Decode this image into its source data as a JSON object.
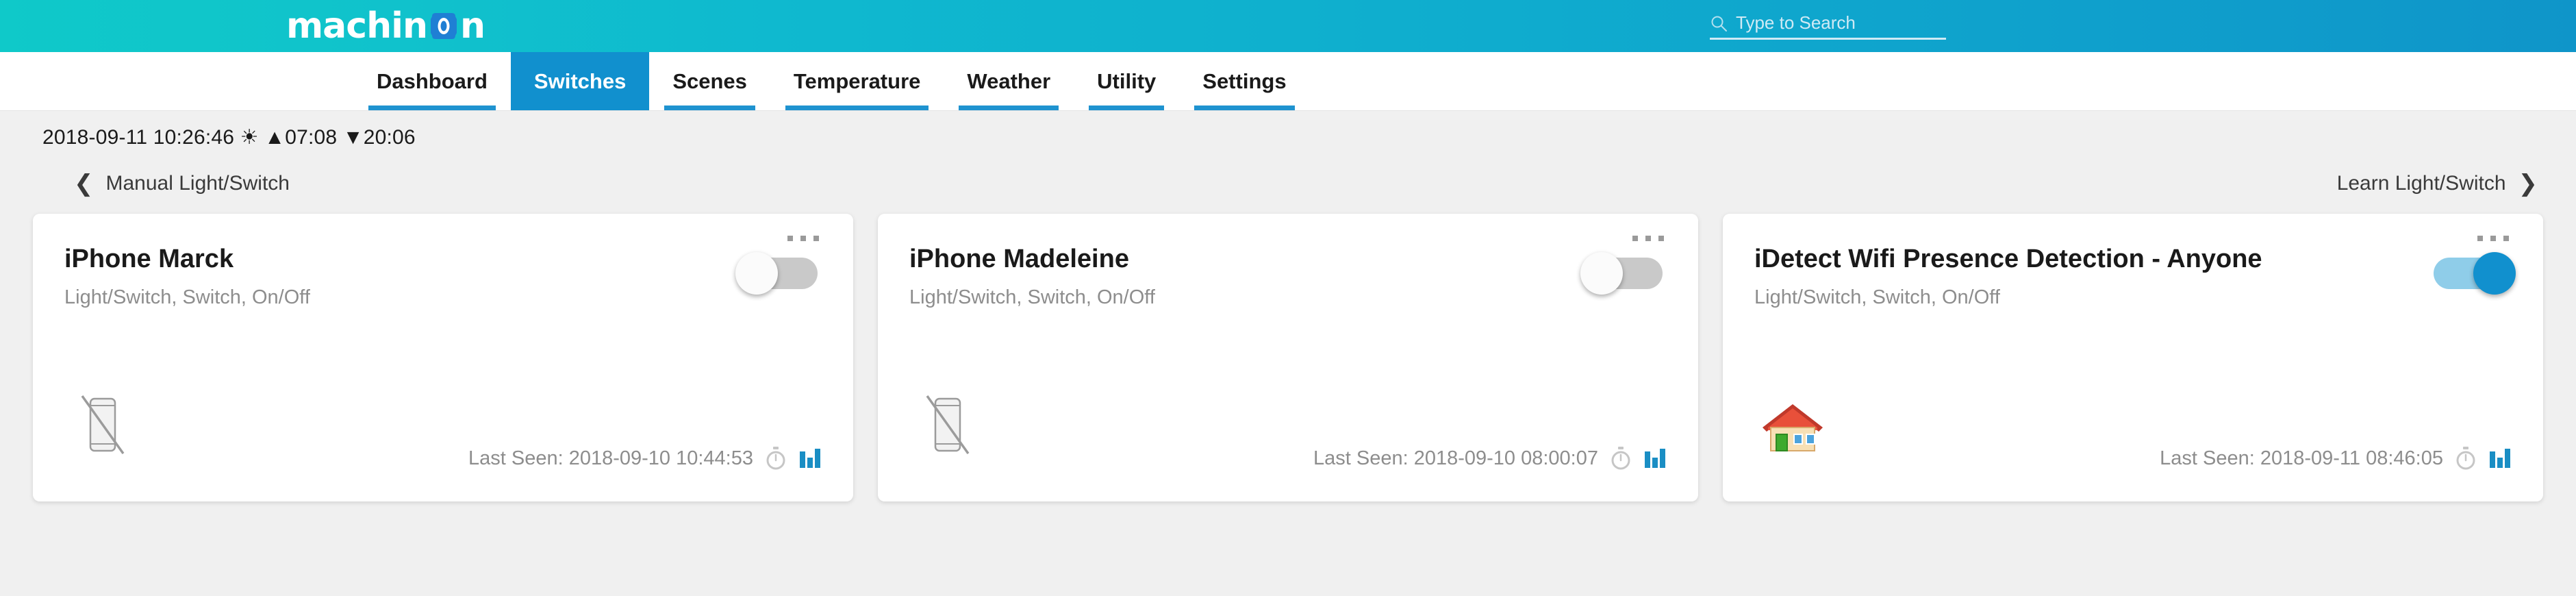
{
  "header": {
    "logo_text_before": "machin",
    "logo_text_after": "n",
    "logo_o_icon": "logo-o-icon",
    "brand_gradient_from": "#0fc9c9",
    "brand_gradient_to": "#0f95c9",
    "search": {
      "icon": "search-icon",
      "placeholder": "Type to Search",
      "value": ""
    }
  },
  "nav": {
    "active_index": 1,
    "active_bg": "#1190ce",
    "underline_color": "#1f93d0",
    "tabs": [
      {
        "label": "Dashboard"
      },
      {
        "label": "Switches"
      },
      {
        "label": "Scenes"
      },
      {
        "label": "Temperature"
      },
      {
        "label": "Weather"
      },
      {
        "label": "Utility"
      },
      {
        "label": "Settings"
      }
    ]
  },
  "statusbar": {
    "text": "2018-09-11 10:26:46 ☀ ▲07:08 ▼20:06",
    "datetime": "2018-09-11 10:26:46",
    "sun_icon": "sun-icon",
    "sunrise_icon": "▲",
    "sunrise": "07:08",
    "sunset_icon": "▼",
    "sunset": "20:06"
  },
  "category_nav": {
    "prev_icon": "chevron-left-icon",
    "prev_label": "Manual Light/Switch",
    "next_label": "Learn Light/Switch",
    "next_icon": "chevron-right-icon"
  },
  "cards": [
    {
      "title": "iPhone Marck",
      "subtitle": "Light/Switch, Switch, On/Off",
      "toggle_state": "off",
      "menu_icon": "overflow-menu-icon",
      "device_icon": "phone-disabled-icon",
      "last_seen": "Last Seen: 2018-09-10 10:44:53",
      "timer_icon": "timer-icon",
      "chart_icon": "bar-chart-icon"
    },
    {
      "title": "iPhone Madeleine",
      "subtitle": "Light/Switch, Switch, On/Off",
      "toggle_state": "off",
      "menu_icon": "overflow-menu-icon",
      "device_icon": "phone-disabled-icon",
      "last_seen": "Last Seen: 2018-09-10 08:00:07",
      "timer_icon": "timer-icon",
      "chart_icon": "bar-chart-icon"
    },
    {
      "title": "iDetect Wifi Presence Detection - Anyone",
      "subtitle": "Light/Switch, Switch, On/Off",
      "toggle_state": "on",
      "menu_icon": "overflow-menu-icon",
      "device_icon": "house-icon",
      "last_seen": "Last Seen: 2018-09-11 08:46:05",
      "timer_icon": "timer-icon",
      "chart_icon": "bar-chart-icon"
    }
  ]
}
